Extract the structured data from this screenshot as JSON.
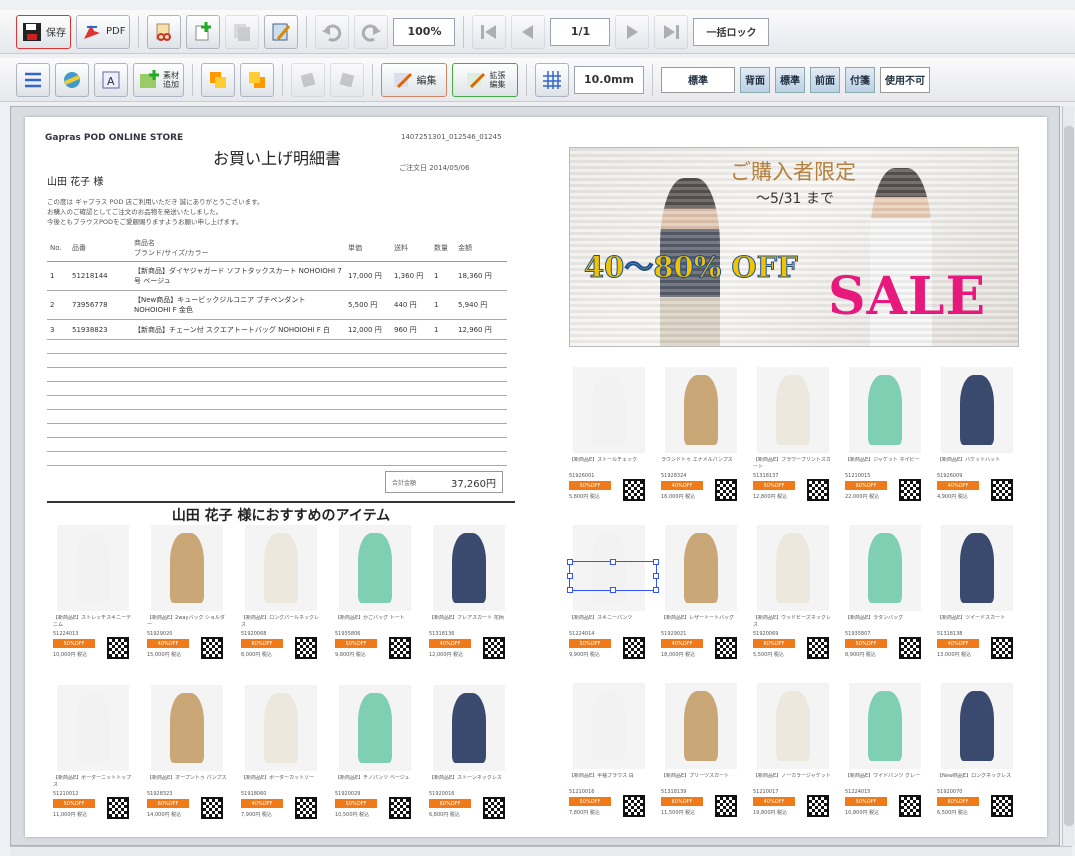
{
  "toolbar1": {
    "save_label": "保存",
    "pdf_label": "PDF",
    "zoom": "100%",
    "page_indicator": "1/1",
    "lock_label": "一括ロック"
  },
  "toolbar2": {
    "material_add_label": "素材\n追加",
    "edit_label": "編集",
    "extended_edit_label": "拡張\n編集",
    "grid_size": "10.0mm",
    "mode_select": "標準",
    "mode_buttons": [
      "背面",
      "標準",
      "前面",
      "付箋",
      "使用不可"
    ]
  },
  "invoice": {
    "brand": "Gapras POD ONLINE STORE",
    "title": "お買い上げ明細書",
    "order_no": "1407251301_012546_01245",
    "date": "ご注文日 2014/05/06",
    "customer": "山田 花子 様",
    "message": "この度は ギャプラス POD 店ご利用いただき 誠にありがとうございます。\nお購入のご確認としてご注文のお品物を発送いたしました。\n今後ともブラウスPODをご愛顧賜りますようお願い申し上げます。",
    "columns": [
      "No.",
      "品番",
      "商品名\nブランド/サイズ/カラー",
      "単価",
      "送料",
      "数量",
      "金額"
    ],
    "rows": [
      [
        "1",
        "51218144",
        "【新商品】ダイヤジャガード ソフトタックスカート NOHOIOHI 7号 ベージュ",
        "17,000 円",
        "1,360 円",
        "1",
        "18,360 円"
      ],
      [
        "2",
        "73956778",
        "【New商品】キュービックジルコニア ブチペンダント NOHOIOHI F 金色",
        "5,500 円",
        "440 円",
        "1",
        "5,940 円"
      ],
      [
        "3",
        "51938823",
        "【新商品】チェーン付 スクエアトートバッグ NOHOIOHI F 白",
        "12,000 円",
        "960 円",
        "1",
        "12,960 円"
      ]
    ],
    "total_label": "合計金額",
    "total": "37,260円"
  },
  "recommend_title": "山田 花子 様におすすめのアイテム",
  "banner": {
    "headline": "ご購入者限定",
    "period": "〜5/31 まで",
    "discount": "40〜80% OFF",
    "sale": "SALE"
  },
  "products_left": [
    {
      "name": "【新商品E】ストレッチスキニーデニム",
      "code": "51224013",
      "badge": "50%OFF",
      "price": "10,000円 税込"
    },
    {
      "name": "【新商品E】2wayバッグ ショルダー",
      "code": "51929020",
      "badge": "40%OFF",
      "price": "15,000円 税込"
    },
    {
      "name": "【新商品E】ロングパールネックレス",
      "code": "51920068",
      "badge": "60%OFF",
      "price": "8,000円 税込"
    },
    {
      "name": "【新商品E】かごバッグ トート",
      "code": "51935806",
      "badge": "50%OFF",
      "price": "9,800円 税込"
    },
    {
      "name": "【新商品E】フレアスカート 花柄",
      "code": "51318136",
      "badge": "40%OFF",
      "price": "12,000円 税込"
    },
    {
      "name": "【新商品E】ボーダーニットトップス",
      "code": "51210012",
      "badge": "50%OFF",
      "price": "11,000円 税込"
    },
    {
      "name": "【新商品E】オープントゥ パンプス",
      "code": "51928323",
      "badge": "60%OFF",
      "price": "14,000円 税込"
    },
    {
      "name": "【新商品E】ボーダーカットソー",
      "code": "51918060",
      "badge": "40%OFF",
      "price": "7,900円 税込"
    },
    {
      "name": "【新商品E】チノパンツ ベージュ",
      "code": "51920029",
      "badge": "50%OFF",
      "price": "10,500円 税込"
    },
    {
      "name": "【新商品E】ストーンネックレス",
      "code": "51920016",
      "badge": "60%OFF",
      "price": "6,800円 税込"
    }
  ],
  "products_right": [
    {
      "name": "【新商品E】ストールチェック",
      "code": "51926001",
      "badge": "50%OFF",
      "price": "5,800円 税込"
    },
    {
      "name": "ラウンドトゥ エナメルパンプス",
      "code": "51928324",
      "badge": "40%OFF",
      "price": "16,000円 税込"
    },
    {
      "name": "【新商品E】フラワープリントスカート",
      "code": "51318137",
      "badge": "50%OFF",
      "price": "12,800円 税込"
    },
    {
      "name": "【新商品E】ジャケット ネイビー",
      "code": "51210015",
      "badge": "60%OFF",
      "price": "22,000円 税込"
    },
    {
      "name": "【新商品E】バケットハット",
      "code": "51926009",
      "badge": "40%OFF",
      "price": "4,900円 税込"
    },
    {
      "name": "【新商品E】スキニーパンツ",
      "code": "51224014",
      "badge": "50%OFF",
      "price": "9,900円 税込"
    },
    {
      "name": "【新商品E】レザートートバッグ",
      "code": "51929021",
      "badge": "40%OFF",
      "price": "18,000円 税込"
    },
    {
      "name": "【新商品E】ウッドビーズネックレス",
      "code": "51920069",
      "badge": "60%OFF",
      "price": "5,500円 税込"
    },
    {
      "name": "【新商品E】ラタンバッグ",
      "code": "51935807",
      "badge": "50%OFF",
      "price": "8,900円 税込"
    },
    {
      "name": "【新商品E】ツイードスカート",
      "code": "51318138",
      "badge": "40%OFF",
      "price": "13,000円 税込"
    },
    {
      "name": "【新商品E】半袖ブラウス 白",
      "code": "51210016",
      "badge": "50%OFF",
      "price": "7,800円 税込"
    },
    {
      "name": "【新商品E】プリーツスカート",
      "code": "51318139",
      "badge": "60%OFF",
      "price": "11,500円 税込"
    },
    {
      "name": "【新商品E】ノーカラージャケット",
      "code": "51210017",
      "badge": "40%OFF",
      "price": "19,800円 税込"
    },
    {
      "name": "【新商品E】ワイドパンツ グレー",
      "code": "51224015",
      "badge": "50%OFF",
      "price": "10,800円 税込"
    },
    {
      "name": "【New商品E】ロングネックレス",
      "code": "51920070",
      "badge": "60%OFF",
      "price": "6,500円 税込"
    }
  ]
}
